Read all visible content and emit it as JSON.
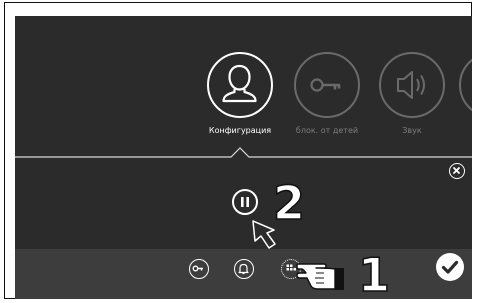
{
  "categories": [
    {
      "label": "Конфигурация",
      "icon": "user-icon",
      "state": "active"
    },
    {
      "label": "блок. от детей",
      "icon": "key-icon",
      "state": "inactive"
    },
    {
      "label": "Звук",
      "icon": "speaker-icon",
      "state": "inactive"
    },
    {
      "label": "",
      "icon": "partial-icon",
      "state": "inactive"
    }
  ],
  "controls": {
    "close_icon": "close-icon",
    "pause_icon": "pause-icon"
  },
  "bottom_bar": {
    "icons": [
      "key-icon",
      "bell-icon",
      "grid-icon"
    ],
    "confirm_icon": "checkmark-icon"
  },
  "annotations": {
    "step1": "1",
    "step2": "2"
  },
  "colors": {
    "screen_bg": "#2b2b2b",
    "bar_bg": "#3d3d3d",
    "active": "#ffffff",
    "inactive": "#6a6a6a"
  }
}
